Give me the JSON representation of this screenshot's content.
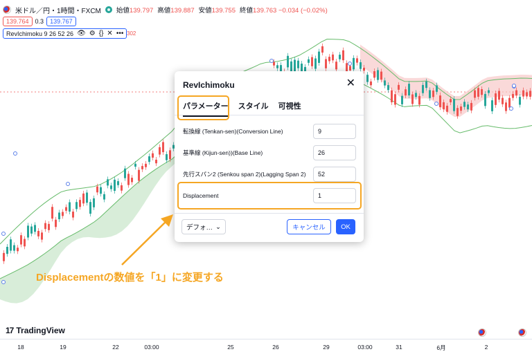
{
  "ticker": {
    "symbol": "米ドル／円・1時間・FXCM",
    "ohlc": [
      {
        "label": "始値",
        "value": "139.797"
      },
      {
        "label": "高値",
        "value": "139.887"
      },
      {
        "label": "安値",
        "value": "139.755"
      },
      {
        "label": "終値",
        "value": "139.763 −0.034 (−0.02%)"
      }
    ],
    "bid": "139.764",
    "spread": "0.3",
    "ask": "139.767"
  },
  "indicator": {
    "label": "RevIchimoku 9 26 52 26",
    "trailing_value": "302"
  },
  "dialog": {
    "title": "RevIchimoku",
    "tabs": [
      {
        "label": "パラメーター",
        "active": true
      },
      {
        "label": "スタイル",
        "active": false
      },
      {
        "label": "可視性",
        "active": false
      }
    ],
    "params": [
      {
        "label": "転換線 (Tenkan-sen)(Conversion Line)",
        "value": "9"
      },
      {
        "label": "基準線 (Kijun-sen))(Base Line)",
        "value": "26"
      },
      {
        "label": "先行スパン2 (Senkou span 2)(Lagging Span 2)",
        "value": "52"
      },
      {
        "label": "Displacement",
        "value": "1"
      }
    ],
    "defaults_label": "デフォ…",
    "cancel_label": "キャンセル",
    "ok_label": "OK"
  },
  "annotation": {
    "text": "Displacementの数値を「1」に変更する",
    "color": "#f5a623"
  },
  "brand": {
    "logo_mark": "17",
    "name": "TradingView"
  },
  "x_axis": {
    "ticks": [
      "18",
      "19",
      "22",
      "03:00",
      "25",
      "26",
      "29",
      "03:00",
      "31",
      "6月",
      "2"
    ]
  },
  "colors": {
    "up": "#26a69a",
    "down": "#ef5350",
    "accent": "#2962ff",
    "cloud_green": "#c8e6c9",
    "cloud_red": "#f8c9c9"
  }
}
